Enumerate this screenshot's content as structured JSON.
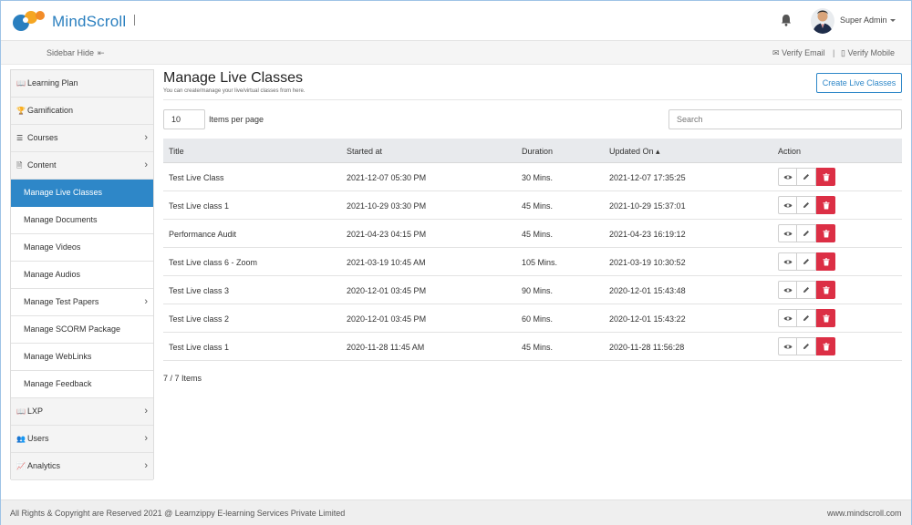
{
  "app": {
    "brand": "MindScroll"
  },
  "header": {
    "user_name": "Super Admin"
  },
  "subbar": {
    "sidebar_hide": "Sidebar Hide",
    "sidebar_hide_icon": "⇤",
    "verify_email": "Verify Email",
    "separator": "|",
    "verify_mobile": "Verify Mobile"
  },
  "sidebar": {
    "items": [
      {
        "label": "Learning Plan",
        "icon": "book-icon",
        "glyph": "📖",
        "chevron": false,
        "sub": false,
        "active": false
      },
      {
        "label": "Gamification",
        "icon": "trophy-icon",
        "glyph": "🏆",
        "chevron": false,
        "sub": false,
        "active": false
      },
      {
        "label": "Courses",
        "icon": "list-icon",
        "glyph": "☰",
        "chevron": true,
        "sub": false,
        "active": false
      },
      {
        "label": "Content",
        "icon": "file-icon",
        "glyph": "🗎",
        "chevron": true,
        "sub": false,
        "active": false
      },
      {
        "label": "Manage Live Classes",
        "chevron": false,
        "sub": true,
        "active": true
      },
      {
        "label": "Manage Documents",
        "chevron": false,
        "sub": true,
        "active": false
      },
      {
        "label": "Manage Videos",
        "chevron": false,
        "sub": true,
        "active": false
      },
      {
        "label": "Manage Audios",
        "chevron": false,
        "sub": true,
        "active": false
      },
      {
        "label": "Manage Test Papers",
        "chevron": true,
        "sub": true,
        "active": false
      },
      {
        "label": "Manage SCORM Package",
        "chevron": false,
        "sub": true,
        "active": false
      },
      {
        "label": "Manage WebLinks",
        "chevron": false,
        "sub": true,
        "active": false
      },
      {
        "label": "Manage Feedback",
        "chevron": false,
        "sub": true,
        "active": false
      },
      {
        "label": "LXP",
        "icon": "book-open-icon",
        "glyph": "📖",
        "chevron": true,
        "sub": false,
        "active": false
      },
      {
        "label": "Users",
        "icon": "users-icon",
        "glyph": "👥",
        "chevron": true,
        "sub": false,
        "active": false
      },
      {
        "label": "Analytics",
        "icon": "chart-icon",
        "glyph": "📈",
        "chevron": true,
        "sub": false,
        "active": false
      }
    ]
  },
  "main": {
    "title": "Manage Live Classes",
    "subtitle": "You can create/manage your live/virtual classes from here.",
    "create_button": "Create Live Classes",
    "items_per_page_value": "10",
    "items_per_page_label": "Items per page",
    "search_placeholder": "Search",
    "columns": [
      "Title",
      "Started at",
      "Duration",
      "Updated On ▴",
      "Action"
    ],
    "rows": [
      [
        "Test Live Class",
        "2021-12-07 05:30 PM",
        "30 Mins.",
        "2021-12-07 17:35:25"
      ],
      [
        "Test Live class 1",
        "2021-10-29 03:30 PM",
        "45 Mins.",
        "2021-10-29 15:37:01"
      ],
      [
        "Performance Audit",
        "2021-04-23 04:15 PM",
        "45 Mins.",
        "2021-04-23 16:19:12"
      ],
      [
        "Test Live class 6 - Zoom",
        "2021-03-19 10:45 AM",
        "105 Mins.",
        "2021-03-19 10:30:52"
      ],
      [
        "Test Live class 3",
        "2020-12-01 03:45 PM",
        "90 Mins.",
        "2020-12-01 15:43:48"
      ],
      [
        "Test Live class 2",
        "2020-12-01 03:45 PM",
        "60 Mins.",
        "2020-12-01 15:43:22"
      ],
      [
        "Test Live class 1",
        "2020-11-28 11:45 AM",
        "45 Mins.",
        "2020-11-28 11:56:28"
      ]
    ],
    "items_count": "7 / 7 Items"
  },
  "footer": {
    "copyright": "All Rights & Copyright are Reserved 2021 @ Learnzippy E-learning Services Private Limited",
    "site": "www.mindscroll.com"
  },
  "colors": {
    "accent": "#2e87c8",
    "danger": "#dc2f45"
  }
}
